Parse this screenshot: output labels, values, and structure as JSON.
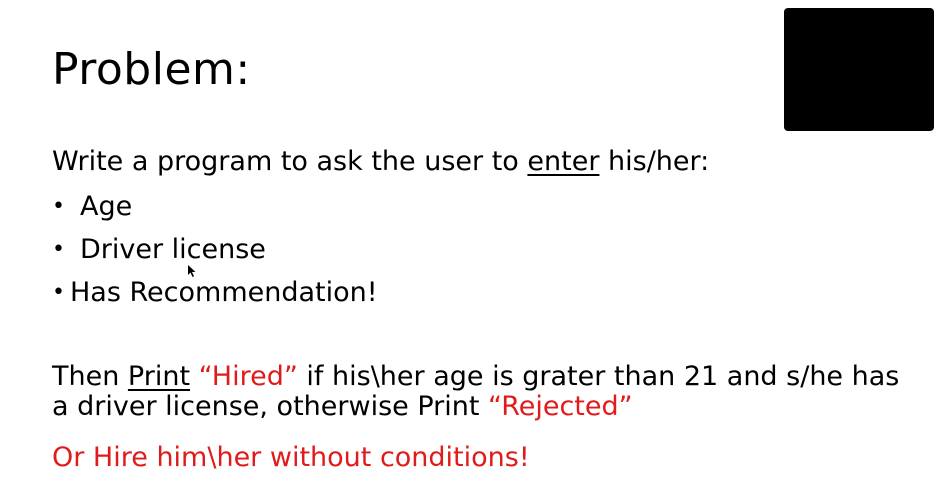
{
  "title": "Problem:",
  "intro": {
    "before": "Write a program to ask the user to ",
    "underlined": "enter",
    "after": " his/her:"
  },
  "bullets": [
    {
      "marker": "•",
      "text": "Age"
    },
    {
      "marker": "•",
      "text": "Driver license"
    },
    {
      "marker": "•",
      "text": "Has Recommendation!"
    }
  ],
  "paragraph": {
    "p1": "Then ",
    "print1": "Print",
    "space": " ",
    "hired": "“Hired”",
    "p2": " if his\\her age is grater than 21 and s/he has a driver license, otherwise Print ",
    "rejected": "“Rejected”"
  },
  "closing": "Or Hire him\\her without conditions!",
  "colors": {
    "accent_red": "#e01b1b",
    "text": "#000000",
    "background": "#ffffff"
  }
}
